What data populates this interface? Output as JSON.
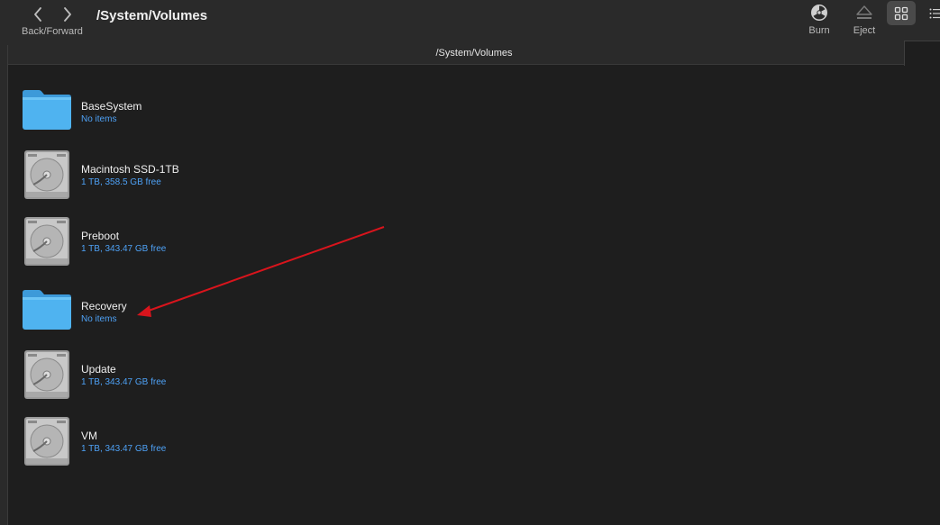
{
  "toolbar": {
    "nav_label": "Back/Forward",
    "title": "/System/Volumes",
    "burn_label": "Burn",
    "eject_label": "Eject"
  },
  "pathbar": {
    "path": "/System/Volumes"
  },
  "items": [
    {
      "name": "BaseSystem",
      "info": "No items",
      "kind": "folder-icon"
    },
    {
      "name": "Macintosh SSD-1TB",
      "info": "1 TB, 358.5 GB free",
      "kind": "hard-drive-icon"
    },
    {
      "name": "Preboot",
      "info": "1 TB, 343.47 GB free",
      "kind": "hard-drive-icon"
    },
    {
      "name": "Recovery",
      "info": "No items",
      "kind": "folder-icon"
    },
    {
      "name": "Update",
      "info": "1 TB, 343.47 GB free",
      "kind": "hard-drive-icon"
    },
    {
      "name": "VM",
      "info": "1 TB, 343.47 GB free",
      "kind": "hard-drive-icon"
    }
  ],
  "colors": {
    "background": "#1e1e1e",
    "toolbar": "#2a2a2a",
    "info_text": "#4ea1f5",
    "folder": "#4fb3f0",
    "annotation_arrow": "#d9141c"
  }
}
